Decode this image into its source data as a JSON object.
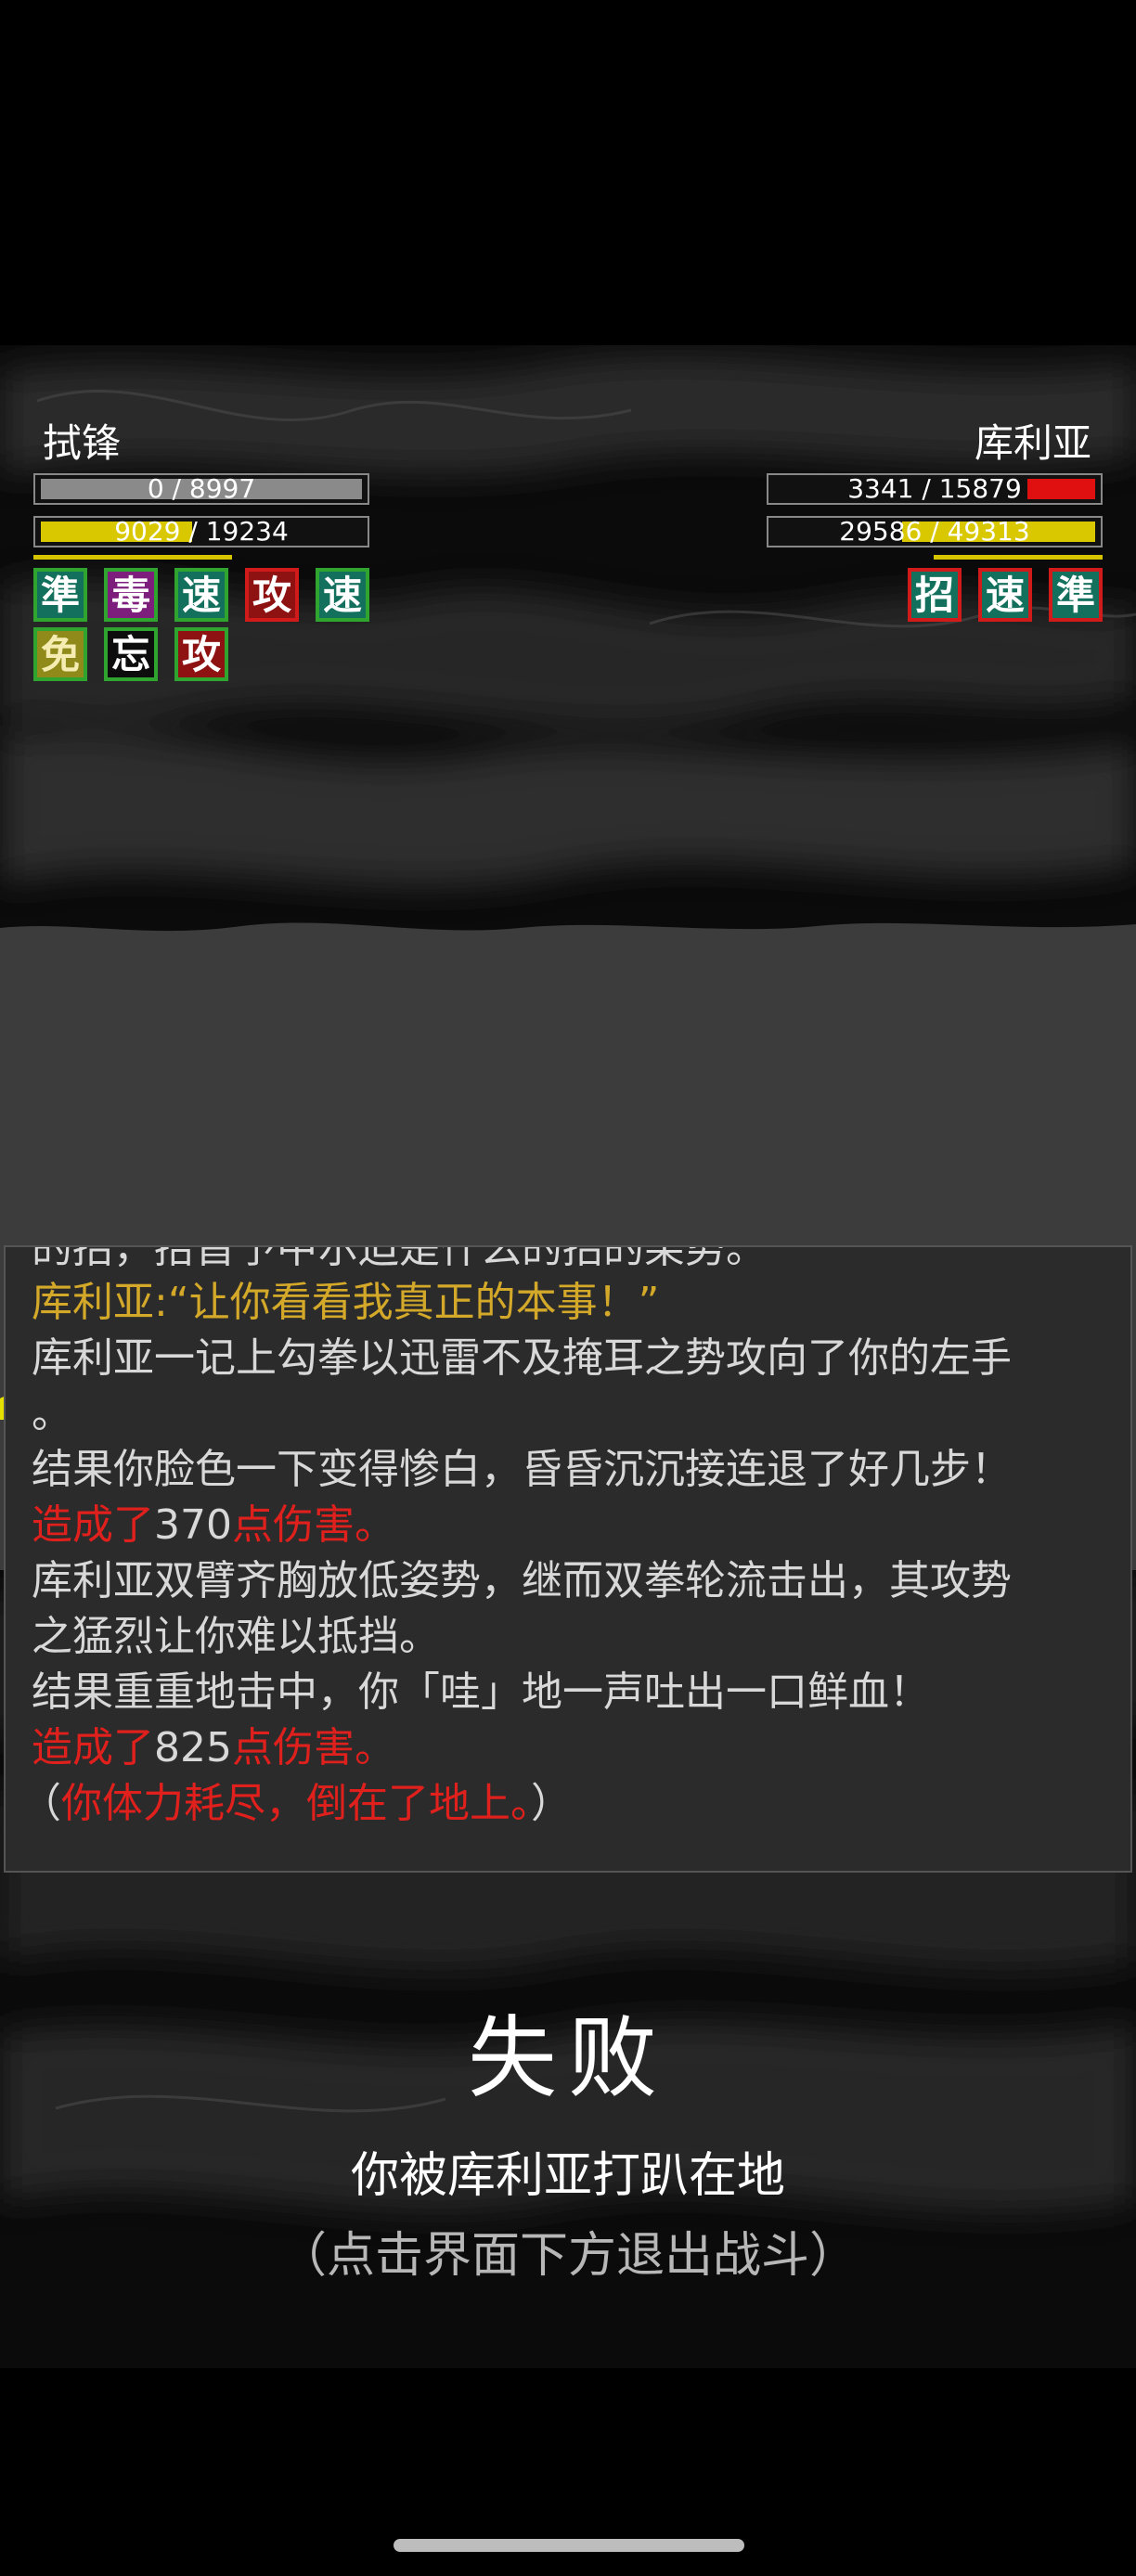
{
  "player": {
    "name": "拭锋",
    "hp_text": "0 / 8997",
    "hp_fraction": 0.0,
    "energy_text": "9029 / 19234",
    "energy_fraction": 0.47,
    "buffs_row1": [
      "準",
      "毒",
      "速",
      "攻",
      "速"
    ],
    "buffs_row2": [
      "免",
      "忘",
      "攻"
    ]
  },
  "enemy": {
    "name": "库利亚",
    "hp_text": "3341 / 15879",
    "hp_fraction": 0.21,
    "energy_text": "29586 / 49313",
    "energy_fraction": 0.6,
    "buffs": [
      "招",
      "速",
      "準"
    ]
  },
  "log": {
    "line0": "的招，抬首予中尔迫是什么的招的架势。",
    "line1": "库利亚:“让你看看我真正的本事！”",
    "line2": "库利亚一记上勾拳以迅雷不及掩耳之势攻向了你的左手",
    "line3": "。",
    "line4": "结果你脸色一下变得惨白，昏昏沉沉接连退了好几步！",
    "line5_pre": "造成了",
    "line5_num": "370",
    "line5_post": "点伤害。",
    "line6": "库利亚双臂齐胸放低姿势，继而双拳轮流击出，其攻势",
    "line7": "之猛烈让你难以抵挡。",
    "line8": "结果重重地击中，你「哇」地一声吐出一口鲜血！",
    "line9_pre": "造成了",
    "line9_num": "825",
    "line9_post": "点伤害。",
    "line10_open": "（",
    "line10_text": "你体力耗尽，倒在了地上。",
    "line10_close": "）"
  },
  "result": {
    "title": "失败",
    "subtitle": "你被库利亚打趴在地",
    "hint": "（点击界面下方退出战斗）"
  },
  "colors": {
    "hp_bar": "#8a8a8a",
    "enemy_hp_bar": "#e01010",
    "energy_bar": "#d9c800",
    "log_quote": "#d4a92a",
    "damage": "#e0201c"
  }
}
